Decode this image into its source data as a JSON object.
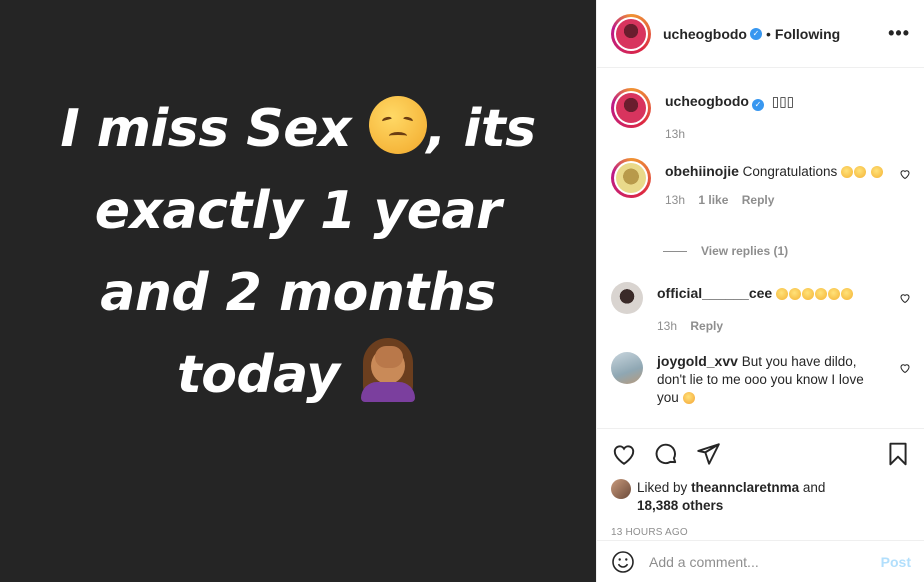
{
  "post": {
    "image_lines": [
      "I miss Sex",
      ", its",
      "exactly 1 year",
      "and 2 months",
      "today"
    ],
    "image_emojis": [
      "disappointed-face-emoji",
      "woman-facepalming-emoji"
    ]
  },
  "header": {
    "username": "ucheogbodo",
    "separator": "•",
    "following_label": "Following",
    "more_label": "•••"
  },
  "caption": {
    "username": "ucheogbodo",
    "text": "▯▯▯",
    "time": "13h"
  },
  "comments": [
    {
      "username": "obehiinojie",
      "text": "Congratulations",
      "emoji_count": 3,
      "time": "13h",
      "likes": "1 like",
      "reply_label": "Reply",
      "view_replies": "View replies (1)"
    },
    {
      "username": "official______cee",
      "text": "",
      "emoji_count": 6,
      "time": "13h",
      "reply_label": "Reply"
    },
    {
      "username": "joygold_xvv",
      "text": "But you have dildo, don't lie to me ooo you know I love you",
      "emoji_count": 1
    }
  ],
  "likes": {
    "prefix": "Liked by",
    "user": "theannclaretnma",
    "and": "and",
    "others": "18,388 others"
  },
  "timestamp": "13 HOURS AGO",
  "add_comment": {
    "placeholder": "Add a comment...",
    "post_label": "Post"
  },
  "colors": {
    "image_bg": "#252525",
    "verified": "#3897f0",
    "post_button_disabled": "#b2dffc",
    "muted_text": "#8e8e8e"
  }
}
